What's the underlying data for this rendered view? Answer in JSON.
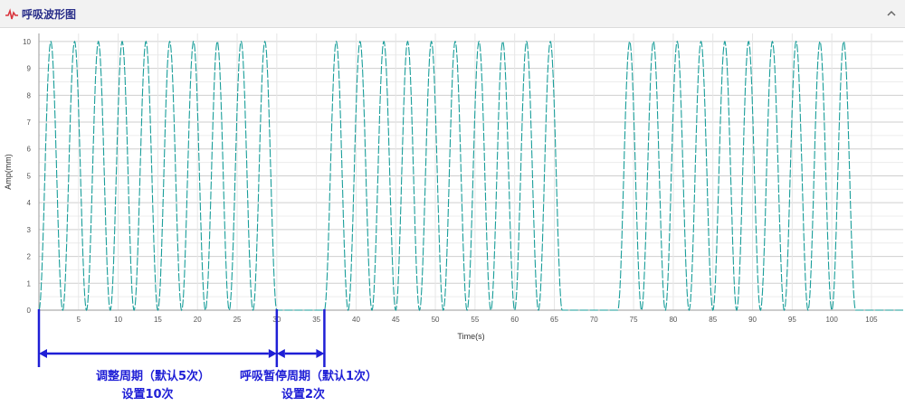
{
  "panel": {
    "title": "呼吸波形图",
    "icon": "waveform-icon",
    "collapse_icon": "chevron-up-icon"
  },
  "chart_data": {
    "type": "line",
    "xlabel": "Time(s)",
    "ylabel": "Amp(mm)",
    "xlim": [
      0,
      109
    ],
    "ylim": [
      0,
      10.3
    ],
    "x_ticks": [
      5,
      10,
      15,
      20,
      25,
      30,
      35,
      40,
      45,
      50,
      55,
      60,
      65,
      70,
      75,
      80,
      85,
      90,
      95,
      100,
      105
    ],
    "y_ticks": [
      0,
      1,
      2,
      3,
      4,
      5,
      6,
      7,
      8,
      9,
      10
    ],
    "grid": true,
    "line_color": "#1a9e9a",
    "series": [
      {
        "segments": [
          {
            "type": "oscillation",
            "start": 0,
            "end": 30,
            "period": 3,
            "min": 0,
            "max": 10
          },
          {
            "type": "flat",
            "start": 30,
            "end": 36,
            "value": 0
          },
          {
            "type": "oscillation",
            "start": 36,
            "end": 66,
            "period": 3,
            "min": 0,
            "max": 10
          },
          {
            "type": "flat",
            "start": 66,
            "end": 73,
            "value": 0
          },
          {
            "type": "oscillation",
            "start": 73,
            "end": 103,
            "period": 3,
            "min": 0,
            "max": 10
          },
          {
            "type": "flat",
            "start": 103,
            "end": 109,
            "value": 0
          }
        ]
      }
    ],
    "annotations": {
      "color": "#1f1fd6",
      "markers_at": [
        0,
        30,
        36
      ],
      "cycle": {
        "start": 0,
        "end": 30,
        "line1": "调整周期（默认5次）",
        "line2": "设置10次"
      },
      "pause": {
        "start": 30,
        "end": 36,
        "line1": "呼吸暂停周期（默认1次）",
        "line2": "设置2次"
      }
    }
  }
}
